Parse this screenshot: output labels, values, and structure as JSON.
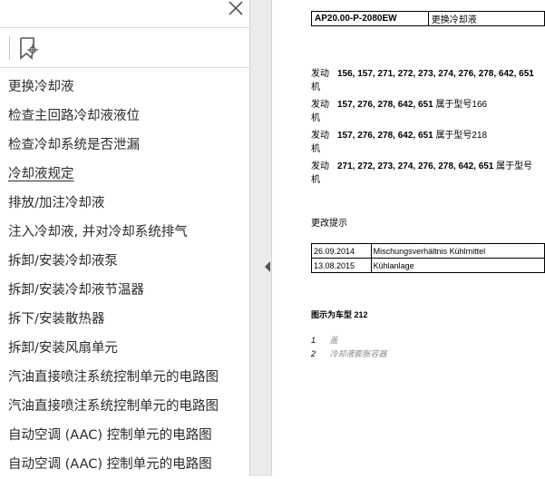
{
  "sidebar": {
    "items": [
      {
        "label": "更换冷却液"
      },
      {
        "label": "检查主回路冷却液液位"
      },
      {
        "label": "检查冷却系统是否泄漏"
      },
      {
        "label": "冷却液规定",
        "active": true
      },
      {
        "label": "排放/加注冷却液"
      },
      {
        "label": "注入冷却液, 并对冷却系统排气"
      },
      {
        "label": "拆卸/安装冷却液泵"
      },
      {
        "label": "拆卸/安装冷却液节温器"
      },
      {
        "label": "拆下/安装散热器"
      },
      {
        "label": "拆卸/安装风扇单元"
      },
      {
        "label": "汽油直接喷注系统控制单元的电路图"
      },
      {
        "label": "汽油直接喷注系统控制单元的电路图"
      },
      {
        "label": "自动空调 (AAC) 控制单元的电路图"
      },
      {
        "label": "自动空调 (AAC) 控制单元的电路图"
      }
    ]
  },
  "document": {
    "code": "AP20.00-P-2080EW",
    "title": "更换冷却液",
    "engine_label": "发动机",
    "engines": [
      {
        "numbers": "156, 157, 271, 272, 273, 274, 276, 278, 642, 651",
        "suffix": ""
      },
      {
        "numbers": "157, 276, 278, 642, 651 ",
        "suffix": "属于型号166"
      },
      {
        "numbers": "157, 276, 278, 642, 651 ",
        "suffix": "属于型号218"
      },
      {
        "numbers": "271, 272, 273, 274, 276, 278, 642, 651 ",
        "suffix": "属于型号"
      }
    ],
    "change_heading": "更改提示",
    "changes": [
      {
        "date": "26.09.2014",
        "desc": "Mischungsverhältnis Kühlmittel"
      },
      {
        "date": "13.08.2015",
        "desc": "Kühlanlage"
      }
    ],
    "figure_caption": "图示为车型 212",
    "legend": [
      {
        "num": "1",
        "text": "盖"
      },
      {
        "num": "2",
        "text": "冷却液膨胀容器"
      }
    ]
  },
  "icons": {
    "close": "close-icon",
    "bookmark": "bookmark-options-icon",
    "collapse": "collapse-left-icon"
  }
}
